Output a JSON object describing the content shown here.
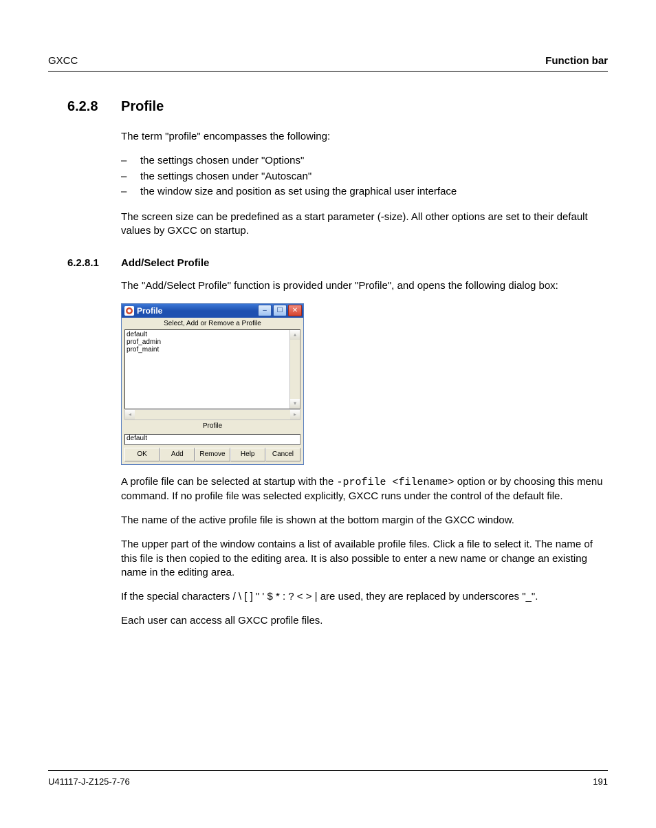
{
  "header": {
    "left": "GXCC",
    "right": "Function bar"
  },
  "section": {
    "num": "6.2.8",
    "title": "Profile"
  },
  "intro": "The term \"profile\" encompasses the following:",
  "bullets": [
    "the settings chosen under \"Options\"",
    "the settings chosen under \"Autoscan\"",
    "the window size and position as set using the graphical user interface"
  ],
  "para_screen": "The screen size can be predefined as a start parameter (-size). All other options are set to their default values by GXCC on startup.",
  "sub": {
    "num": "6.2.8.1",
    "title": "Add/Select Profile"
  },
  "sub_intro": "The \"Add/Select Profile\" function is provided under \"Profile\", and opens the following dialog box:",
  "dialog": {
    "title": "Profile",
    "listLabel": "Select, Add or Remove a Profile",
    "items": [
      "default",
      "prof_admin",
      "prof_maint"
    ],
    "fieldLabel": "Profile",
    "fieldValue": "default",
    "buttons": {
      "ok": "OK",
      "add": "Add",
      "remove": "Remove",
      "help": "Help",
      "cancel": "Cancel"
    }
  },
  "para_after_1a": "A profile file can be selected at startup with the ",
  "code_opt": "-profile <filename>",
  "para_after_1b": " option or by choosing this menu command. If no profile file was selected explicitly, GXCC runs under the control of the default file.",
  "para_after_2": "The name of the active profile file is shown at the bottom margin of the GXCC window.",
  "para_after_3": "The upper part of the window contains a list of available profile files. Click a file to select it. The name of this file is then copied to the editing area. It is also possible to enter a new name or change an existing name in the editing area.",
  "para_after_4": "If the special characters / \\ [ ] \" ' $ * : ? < > | are used, they are replaced by underscores \"_\".",
  "para_after_5": "Each user can access all GXCC profile files.",
  "footer": {
    "left": "U41117-J-Z125-7-76",
    "right": "191"
  }
}
